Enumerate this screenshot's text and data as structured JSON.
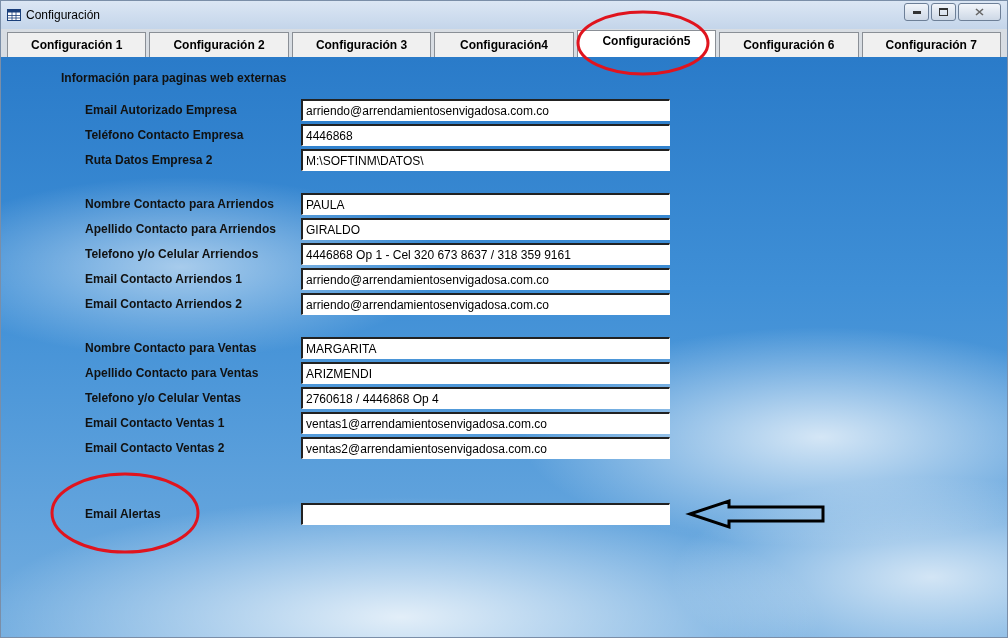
{
  "window": {
    "title": "Configuración"
  },
  "tabs": [
    {
      "label": "Configuración 1",
      "selected": false
    },
    {
      "label": "Configuración 2",
      "selected": false
    },
    {
      "label": "Configuración 3",
      "selected": false
    },
    {
      "label": "Configuración4",
      "selected": false
    },
    {
      "label": "Configuración5",
      "selected": true
    },
    {
      "label": "Configuración 6",
      "selected": false
    },
    {
      "label": "Configuración 7",
      "selected": false
    }
  ],
  "section_title": "Información para paginas web externas",
  "groups": [
    [
      {
        "label": "Email Autorizado Empresa",
        "value": "arriendo@arrendamientosenvigadosa.com.co"
      },
      {
        "label": "Teléfono Contacto Empresa",
        "value": "4446868"
      },
      {
        "label": "Ruta Datos Empresa 2",
        "value": "M:\\SOFTINM\\DATOS\\"
      }
    ],
    [
      {
        "label": "Nombre Contacto para Arriendos",
        "value": "PAULA"
      },
      {
        "label": "Apellido Contacto para Arriendos",
        "value": "GIRALDO"
      },
      {
        "label": "Telefono y/o Celular Arriendos",
        "value": "4446868 Op 1 - Cel 320 673 8637 / 318 359 9161"
      },
      {
        "label": "Email Contacto Arriendos 1",
        "value": "arriendo@arrendamientosenvigadosa.com.co"
      },
      {
        "label": "Email Contacto Arriendos 2",
        "value": "arriendo@arrendamientosenvigadosa.com.co"
      }
    ],
    [
      {
        "label": "Nombre Contacto para Ventas",
        "value": "MARGARITA"
      },
      {
        "label": "Apellido Contacto para Ventas",
        "value": "ARIZMENDI"
      },
      {
        "label": "Telefono y/o Celular Ventas",
        "value": "2760618 / 4446868 Op 4"
      },
      {
        "label": "Email Contacto Ventas 1",
        "value": "ventas1@arrendamientosenvigadosa.com.co"
      },
      {
        "label": "Email Contacto Ventas 2",
        "value": "ventas2@arrendamientosenvigadosa.com.co"
      }
    ],
    [
      {
        "label": "Email Alertas"
      }
    ]
  ]
}
